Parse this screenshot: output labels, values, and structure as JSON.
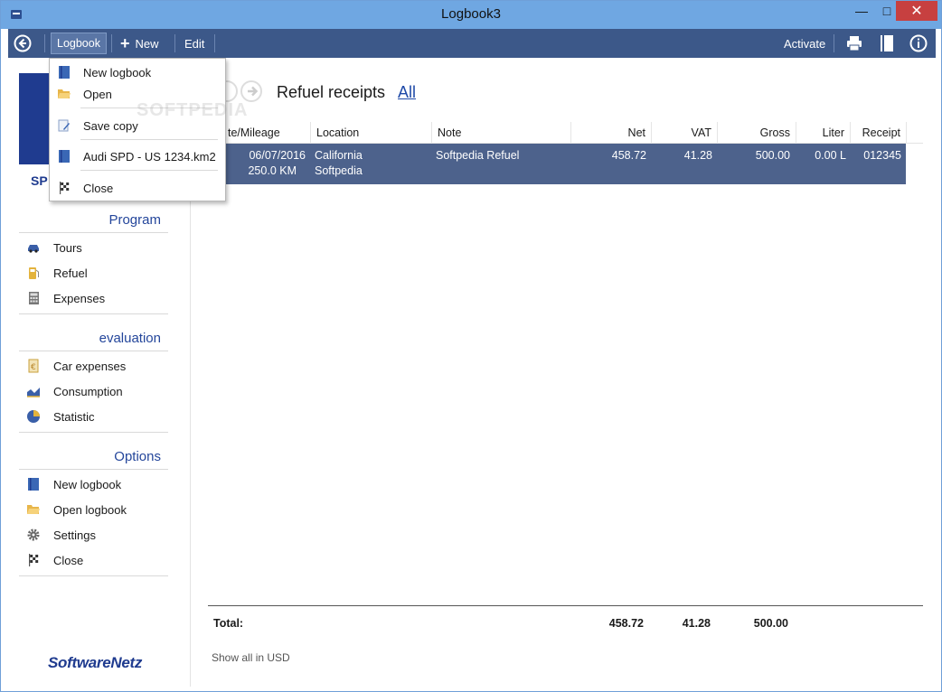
{
  "window": {
    "title": "Logbook3"
  },
  "toolbar": {
    "logbook_label": "Logbook",
    "new_label": "New",
    "edit_label": "Edit",
    "activate_label": "Activate"
  },
  "dropdown": {
    "items": [
      {
        "label": "New logbook",
        "icon": "book-icon"
      },
      {
        "label": "Open",
        "icon": "folder-open-icon"
      },
      {
        "label": "Save copy",
        "icon": "save-copy-icon"
      },
      {
        "label": "Audi SPD - US 1234.km2",
        "icon": "book-icon"
      },
      {
        "label": "Close",
        "icon": "checkered-flag-icon"
      }
    ]
  },
  "sidebar": {
    "logo_text": "SP",
    "sections": [
      {
        "title": "Program",
        "items": [
          {
            "label": "Tours",
            "icon": "car-icon"
          },
          {
            "label": "Refuel",
            "icon": "fuel-icon"
          },
          {
            "label": "Expenses",
            "icon": "calculator-icon"
          }
        ]
      },
      {
        "title": "evaluation",
        "items": [
          {
            "label": "Car expenses",
            "icon": "euro-document-icon"
          },
          {
            "label": "Consumption",
            "icon": "area-chart-icon"
          },
          {
            "label": "Statistic",
            "icon": "pie-chart-icon"
          }
        ]
      },
      {
        "title": "Options",
        "items": [
          {
            "label": "New logbook",
            "icon": "book-icon"
          },
          {
            "label": "Open logbook",
            "icon": "folder-open-icon"
          },
          {
            "label": "Settings",
            "icon": "gear-icon"
          },
          {
            "label": "Close",
            "icon": "checkered-flag-icon"
          }
        ]
      }
    ],
    "brand": "SoftwareNetz"
  },
  "main": {
    "title": "Refuel receipts",
    "filter_link": "All",
    "columns": [
      "te/Mileage",
      "Location",
      "Note",
      "Net",
      "VAT",
      "Gross",
      "Liter",
      "Receipt"
    ],
    "rows": [
      {
        "date": "06/07/2016",
        "mileage": "250.0 KM",
        "location_1": "California",
        "location_2": "Softpedia",
        "note": "Softpedia Refuel",
        "net": "458.72",
        "vat": "41.28",
        "gross": "500.00",
        "liter": "0.00 L",
        "receipt": "012345"
      }
    ],
    "totals": {
      "label": "Total:",
      "net": "458.72",
      "vat": "41.28",
      "gross": "500.00"
    },
    "show_all": "Show all in USD"
  },
  "watermark": "SOFTPEDIA"
}
